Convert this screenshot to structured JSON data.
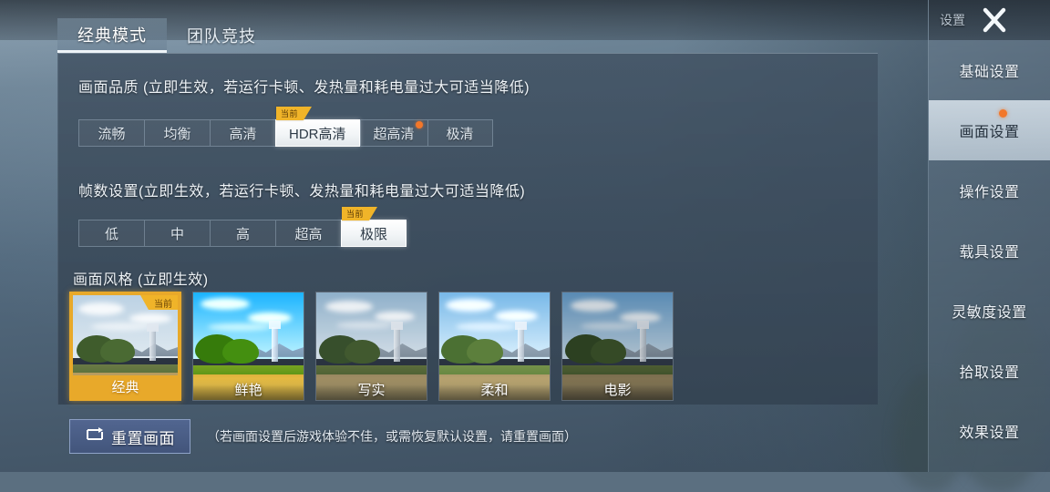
{
  "tabs": [
    {
      "label": "经典模式",
      "active": true
    },
    {
      "label": "团队竞技",
      "active": false
    }
  ],
  "sections": {
    "quality": {
      "title": "画面品质 (立即生效，若运行卡顿、发热量和耗电量过大可适当降低)",
      "options": [
        {
          "label": "流畅",
          "selected": false,
          "dot": false
        },
        {
          "label": "均衡",
          "selected": false,
          "dot": false
        },
        {
          "label": "高清",
          "selected": false,
          "dot": false
        },
        {
          "label": "HDR高清",
          "selected": true,
          "dot": false
        },
        {
          "label": "超高清",
          "selected": false,
          "dot": true
        },
        {
          "label": "极清",
          "selected": false,
          "dot": false
        }
      ]
    },
    "framerate": {
      "title": "帧数设置(立即生效，若运行卡顿、发热量和耗电量过大可适当降低)",
      "options": [
        {
          "label": "低",
          "selected": false,
          "dot": false
        },
        {
          "label": "中",
          "selected": false,
          "dot": false
        },
        {
          "label": "高",
          "selected": false,
          "dot": false
        },
        {
          "label": "超高",
          "selected": false,
          "dot": false
        },
        {
          "label": "极限",
          "selected": true,
          "dot": false
        }
      ]
    },
    "style": {
      "title": "画面风格 (立即生效)",
      "thumbnails": [
        {
          "label": "经典",
          "selected": true,
          "sky_top": "#bcd2e4",
          "sky_bottom": "#dfe9f0",
          "grass": "#4e6b33",
          "dirt": "#b59a5e",
          "saturation": "1.0",
          "brightness": "1.0"
        },
        {
          "label": "鲜艳",
          "selected": false,
          "sky_top": "#3d9fe0",
          "sky_bottom": "#bfe0f2",
          "grass": "#4f7a2a",
          "dirt": "#c0a55a",
          "saturation": "1.45",
          "brightness": "1.08"
        },
        {
          "label": "写实",
          "selected": false,
          "sky_top": "#8fb4d2",
          "sky_bottom": "#d6e3ec",
          "grass": "#415c2c",
          "dirt": "#9d8a5d",
          "saturation": "0.9",
          "brightness": "0.98"
        },
        {
          "label": "柔和",
          "selected": false,
          "sky_top": "#6fb0e0",
          "sky_bottom": "#cfe5f2",
          "grass": "#567a36",
          "dirt": "#a99463",
          "saturation": "0.95",
          "brightness": "1.05"
        },
        {
          "label": "电影",
          "selected": false,
          "sky_top": "#5d9fd6",
          "sky_bottom": "#c4dced",
          "grass": "#3a5526",
          "dirt": "#8e7c52",
          "saturation": "0.85",
          "brightness": "0.88"
        }
      ]
    }
  },
  "badges": {
    "current": "当前"
  },
  "reset": {
    "button_label": "重置画面",
    "icon": "reset-icon",
    "hint": "（若画面设置后游戏体验不佳，或需恢复默认设置，请重置画面）"
  },
  "sidebar": {
    "title": "设置",
    "close_icon": "close-icon",
    "items": [
      {
        "label": "基础设置",
        "active": false,
        "dot": false
      },
      {
        "label": "画面设置",
        "active": true,
        "dot": true
      },
      {
        "label": "操作设置",
        "active": false,
        "dot": false
      },
      {
        "label": "载具设置",
        "active": false,
        "dot": false
      },
      {
        "label": "灵敏度设置",
        "active": false,
        "dot": false
      },
      {
        "label": "拾取设置",
        "active": false,
        "dot": false
      },
      {
        "label": "效果设置",
        "active": false,
        "dot": false
      }
    ]
  },
  "colors": {
    "accent_gold": "#f0b429",
    "accent_orange": "#f2772a",
    "panel_bg": "#425364",
    "selected_chip": "#ffffff"
  }
}
